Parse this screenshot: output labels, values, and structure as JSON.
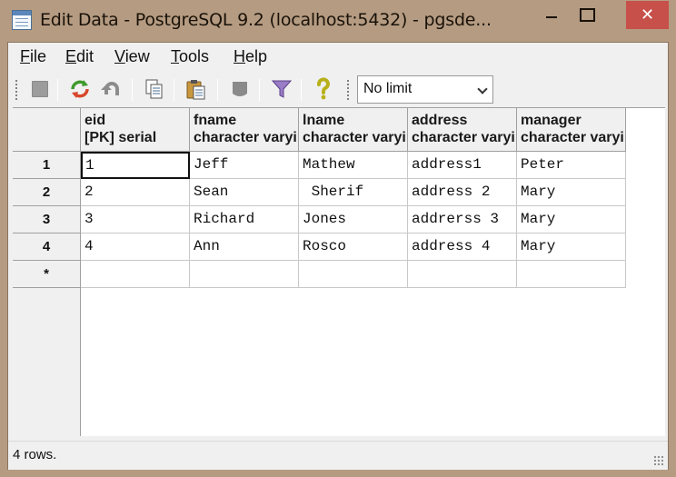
{
  "window": {
    "title": "Edit Data - PostgreSQL 9.2 (localhost:5432) - pgsde...",
    "close_glyph": "✕"
  },
  "menu": [
    {
      "label": "File",
      "ul": "F",
      "rest": "ile"
    },
    {
      "label": "Edit",
      "ul": "E",
      "rest": "dit"
    },
    {
      "label": "View",
      "ul": "V",
      "rest": "iew"
    },
    {
      "label": "Tools",
      "ul": "T",
      "rest": "ools"
    },
    {
      "label": "Help",
      "ul": "H",
      "rest": "elp"
    }
  ],
  "toolbar": {
    "buttons": [
      "save-icon",
      "refresh-icon",
      "undo-icon",
      "copy-icon",
      "paste-icon",
      "delete-icon",
      "filter-icon",
      "help-icon"
    ],
    "limit": {
      "selected": "No limit"
    }
  },
  "table": {
    "columns": [
      {
        "name": "eid",
        "type": "[PK] serial"
      },
      {
        "name": "fname",
        "type": "character varying"
      },
      {
        "name": "lname",
        "type": "character varying"
      },
      {
        "name": "address",
        "type": "character varying"
      },
      {
        "name": "manager",
        "type": "character varying"
      }
    ],
    "rows": [
      {
        "num": "1",
        "cells": [
          "1",
          "Jeff",
          "Mathew",
          "address1",
          "Peter"
        ]
      },
      {
        "num": "2",
        "cells": [
          "2",
          "Sean",
          " Sherif",
          "address 2",
          "Mary"
        ]
      },
      {
        "num": "3",
        "cells": [
          "3",
          "Richard",
          "Jones",
          "addrerss 3",
          "Mary"
        ]
      },
      {
        "num": "4",
        "cells": [
          "4",
          "Ann",
          "Rosco",
          "address 4",
          "Mary"
        ]
      }
    ],
    "new_row_marker": "*"
  },
  "status": {
    "text": "4 rows."
  },
  "colors": {
    "frame": "#b49b82",
    "close_button": "#c7504a",
    "client": "#f0f0f0"
  }
}
